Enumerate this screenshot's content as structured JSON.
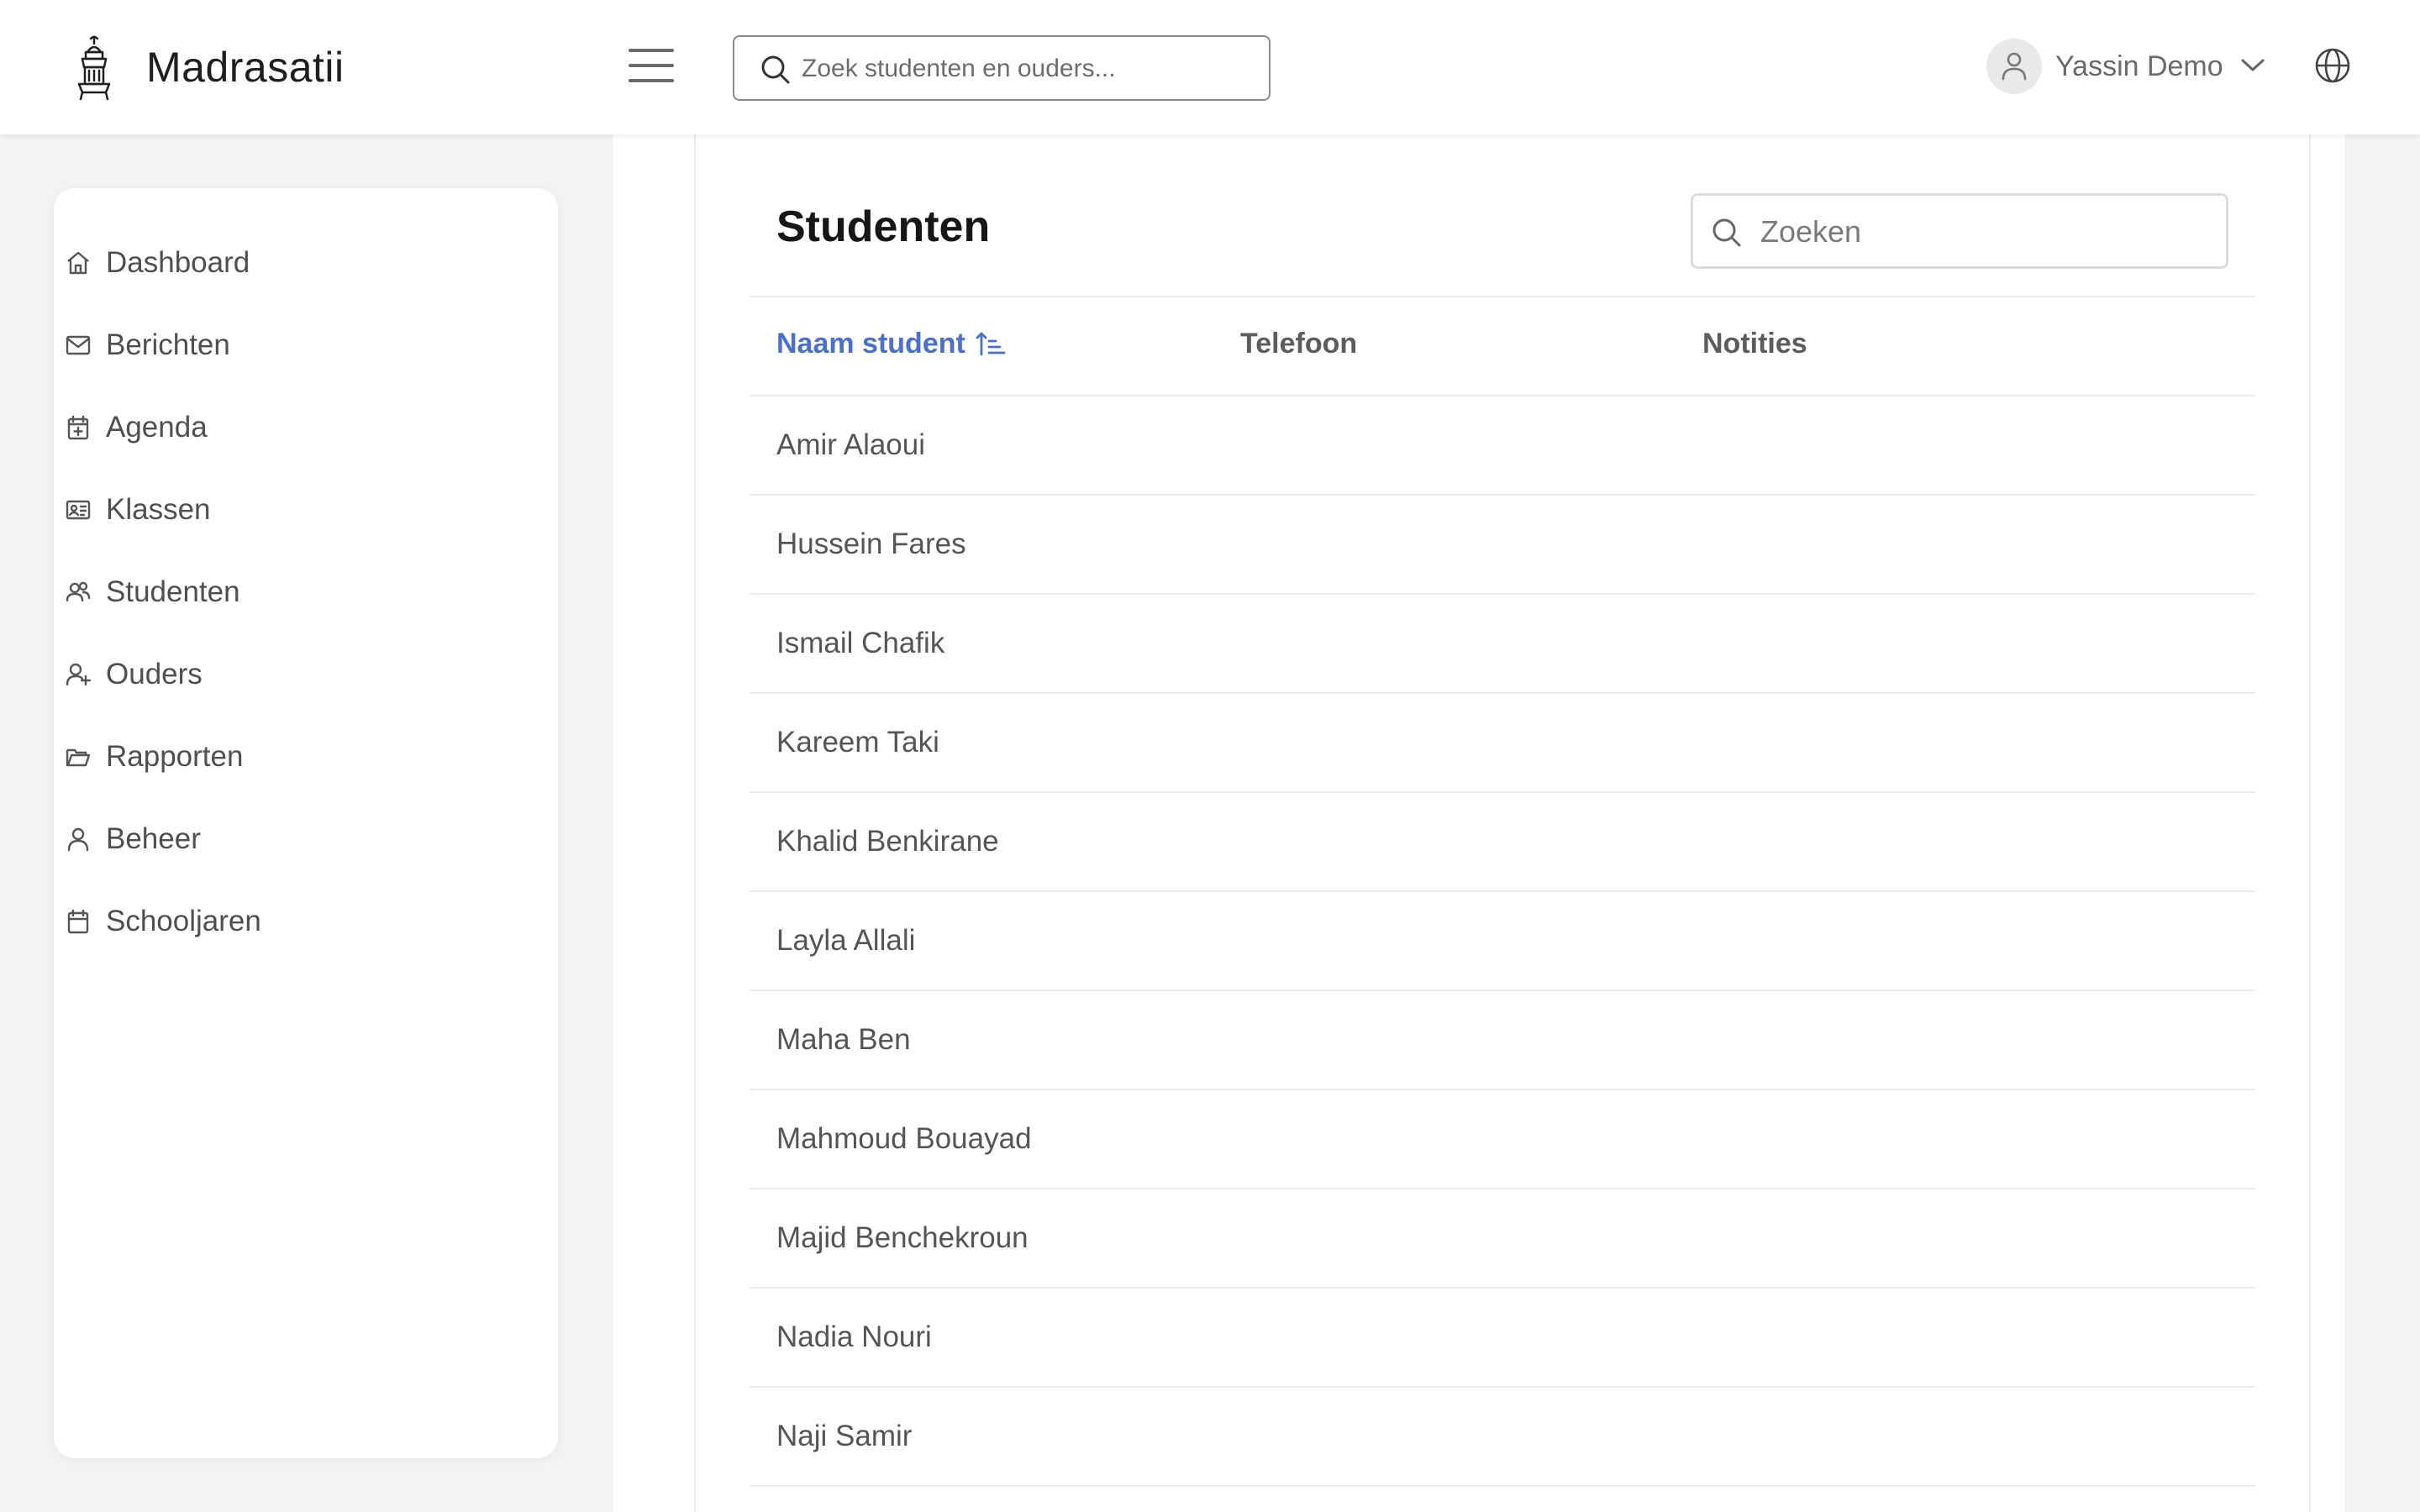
{
  "app": {
    "name": "Madrasatii"
  },
  "header": {
    "search_placeholder": "Zoek studenten en ouders...",
    "user_name": "Yassin Demo"
  },
  "sidebar": {
    "items": [
      {
        "label": "Dashboard",
        "icon": "home-icon"
      },
      {
        "label": "Berichten",
        "icon": "mail-icon"
      },
      {
        "label": "Agenda",
        "icon": "calendar-plus-icon"
      },
      {
        "label": "Klassen",
        "icon": "id-card-icon"
      },
      {
        "label": "Studenten",
        "icon": "users-icon"
      },
      {
        "label": "Ouders",
        "icon": "user-plus-icon"
      },
      {
        "label": "Rapporten",
        "icon": "folder-open-icon"
      },
      {
        "label": "Beheer",
        "icon": "user-icon"
      },
      {
        "label": "Schooljaren",
        "icon": "calendar-icon"
      }
    ]
  },
  "main": {
    "title": "Studenten",
    "search_placeholder": "Zoeken",
    "columns": [
      "Naam student",
      "Telefoon",
      "Notities"
    ],
    "sorted_column": "Naam student",
    "accent_color": "#4a6fd0",
    "rows": [
      {
        "name": "Amir Alaoui",
        "phone": "",
        "notes": ""
      },
      {
        "name": "Hussein Fares",
        "phone": "",
        "notes": ""
      },
      {
        "name": "Ismail Chafik",
        "phone": "",
        "notes": ""
      },
      {
        "name": "Kareem Taki",
        "phone": "",
        "notes": ""
      },
      {
        "name": "Khalid Benkirane",
        "phone": "",
        "notes": ""
      },
      {
        "name": "Layla Allali",
        "phone": "",
        "notes": ""
      },
      {
        "name": "Maha Ben",
        "phone": "",
        "notes": ""
      },
      {
        "name": "Mahmoud Bouayad",
        "phone": "",
        "notes": ""
      },
      {
        "name": "Majid Benchekroun",
        "phone": "",
        "notes": ""
      },
      {
        "name": "Nadia Nouri",
        "phone": "",
        "notes": ""
      },
      {
        "name": "Naji Samir",
        "phone": "",
        "notes": ""
      }
    ]
  }
}
